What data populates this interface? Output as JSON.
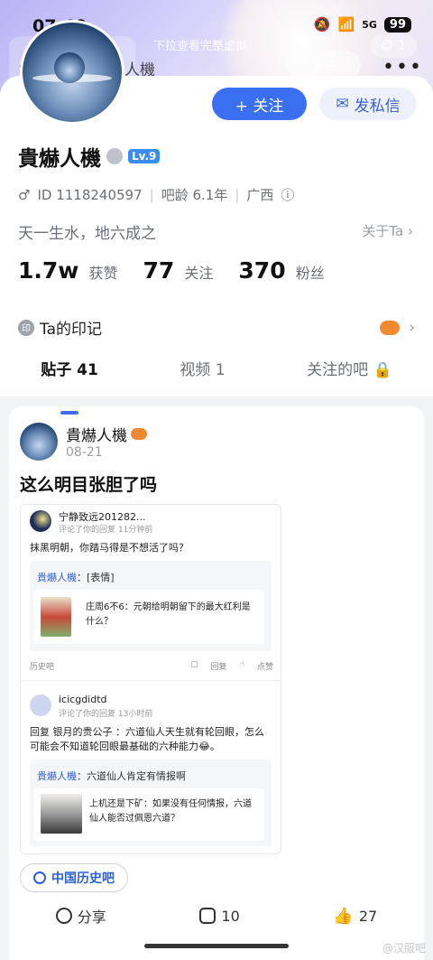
{
  "status_bar": {
    "time": "07:49",
    "network": "5G",
    "battery": "99"
  },
  "header": {
    "hint": "下拉查看完整虚拟",
    "back_label": "<",
    "nav_name": "貴爀人機",
    "top_follow": "关注",
    "emoji_count": "1",
    "more": "•••"
  },
  "profile": {
    "follow_button": "+ 关注",
    "message_button": "发私信",
    "name": "貴爀人機",
    "level": "Lv.9",
    "gender": "♂",
    "id": "ID 1118240597",
    "bar_age": "吧龄 6.1年",
    "region": "广西",
    "signature": "天一生水，地六成之",
    "about_label": "关于Ta",
    "stats": {
      "likes_value": "1.7w",
      "likes_label": "获赞",
      "following_value": "77",
      "following_label": "关注",
      "fans_value": "370",
      "fans_label": "粉丝"
    },
    "mark_label": "Ta的印记",
    "mark_icon_text": "印"
  },
  "tabs": [
    "贴子 41",
    "视频 1",
    "关注的吧"
  ],
  "post": {
    "author": "貴爀人機",
    "date": "08-21",
    "title": "这么明目张胆了吗",
    "screenshot": {
      "c1_name": "宁静致远201282...",
      "c1_sub": "评论了你的回复  11分钟前",
      "c1_text": "抹黑明朝，你踏马得是不想活了吗？",
      "c1_quote_author": "貴爀人機",
      "c1_quote_text": "：[表情]",
      "c1_inner_text": "庄周6不6：元朝给明朝留下的最大红利是什么？",
      "c1_bar": "历史吧",
      "c1_reply": "回复",
      "c1_like": "点赞",
      "c2_name": "icicgdidtd",
      "c2_sub": "评论了你的回复  13小时前",
      "c2_text": "回复 银月的贵公子 ：六道仙人天生就有轮回眼，怎么可能会不知道轮回眼最基础的六种能力😂。",
      "c2_quote_author": "貴爀人機",
      "c2_quote_text": "：六道仙人肯定有情报啊",
      "c2_inner_text": "上机还是下矿：如果没有任何情报，六道仙人能否过佩恩六道？"
    },
    "bar_tag": "中国历史吧",
    "share_label": "分享",
    "comment_count": "10",
    "like_count": "27"
  },
  "watermark": "@汉服吧",
  "colors": {
    "accent": "#3a6ff2",
    "link": "#2b5fd9"
  }
}
